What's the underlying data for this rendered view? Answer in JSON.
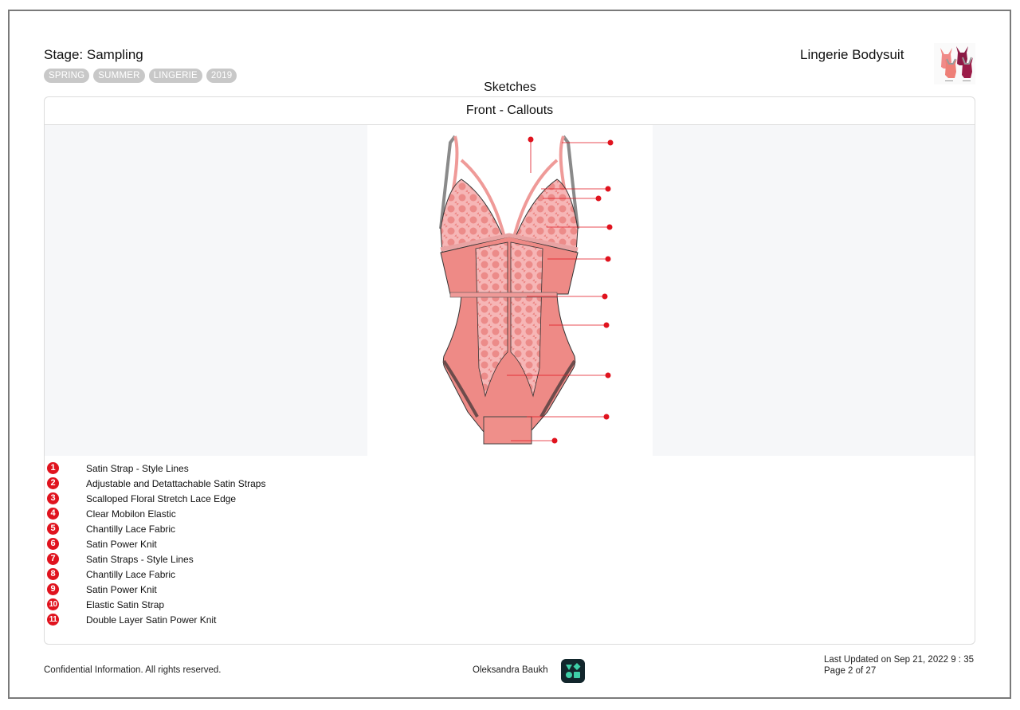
{
  "header": {
    "stage": "Stage: Sampling",
    "tags": [
      "SPRING",
      "SUMMER",
      "LINGERIE",
      "2019"
    ],
    "product_name": "Lingerie Bodysuit",
    "product_thumbnail": "bodysuit-colorways-thumbnail"
  },
  "section": {
    "title": "Sketches",
    "card_title": "Front - Callouts",
    "sketch": "front-lingerie-bodysuit-sketch"
  },
  "colors": {
    "callout_red": "#e0131e",
    "tag_gray": "#c8c8c8",
    "logo_bg": "#12262c",
    "logo_fg": "#3ecfa8",
    "sketch_pink": "#ee8a86"
  },
  "callouts": [
    {
      "num": "1",
      "label": "Satin Strap - Style Lines"
    },
    {
      "num": "2",
      "label": "Adjustable and Detattachable Satin Straps"
    },
    {
      "num": "3",
      "label": "Scalloped Floral Stretch Lace Edge"
    },
    {
      "num": "4",
      "label": "Clear Mobilon Elastic"
    },
    {
      "num": "5",
      "label": "Chantilly Lace Fabric"
    },
    {
      "num": "6",
      "label": "Satin Power Knit"
    },
    {
      "num": "7",
      "label": "Satin Straps - Style Lines"
    },
    {
      "num": "8",
      "label": "Chantilly Lace Fabric"
    },
    {
      "num": "9",
      "label": "Satin Power Knit"
    },
    {
      "num": "10",
      "label": "Elastic Satin Strap"
    },
    {
      "num": "11",
      "label": "Double Layer Satin Power Knit"
    }
  ],
  "footer": {
    "confidential": "Confidential Information. All rights reserved.",
    "author": "Oleksandra Baukh",
    "logo": "brand-shapes-logo",
    "last_updated": "Last Updated on Sep 21, 2022 9 : 35",
    "page": "Page 2 of 27"
  }
}
